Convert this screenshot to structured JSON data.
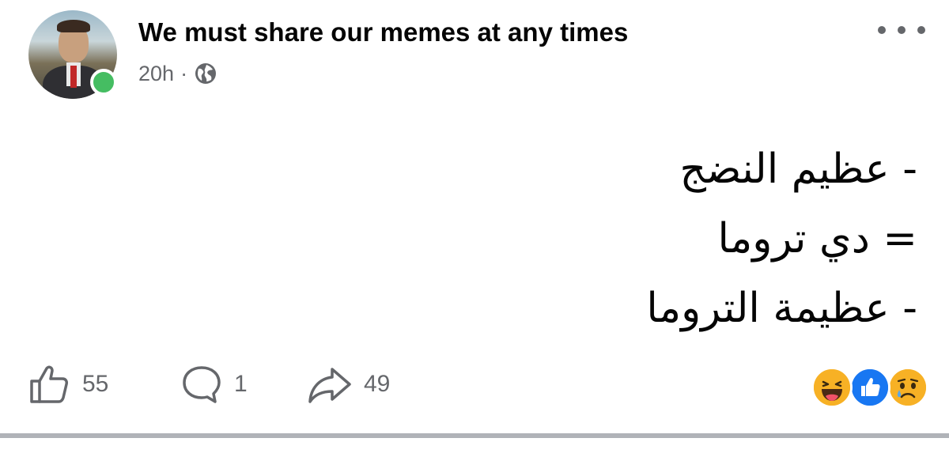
{
  "post": {
    "group_name": "We must share our memes at any times",
    "time": "20h",
    "separator": "·",
    "privacy_icon": "globe-icon",
    "more_icon": "more-options-icon",
    "text_lines": [
      "- عظيم النضج",
      "= دي تروما",
      "- عظيمة التروما"
    ]
  },
  "actions": {
    "like": {
      "icon": "thumbs-up-icon",
      "count": "55"
    },
    "comment": {
      "icon": "comment-icon",
      "count": "1"
    },
    "share": {
      "icon": "share-arrow-icon",
      "count": "49"
    }
  },
  "reactions": [
    "haha",
    "like",
    "sad"
  ],
  "colors": {
    "text": "#050505",
    "secondary": "#65676b",
    "online": "#45bd62",
    "like_blue": "#1877f2",
    "emoji_yellow": "#f7b125",
    "divider": "#b0b3b8"
  }
}
